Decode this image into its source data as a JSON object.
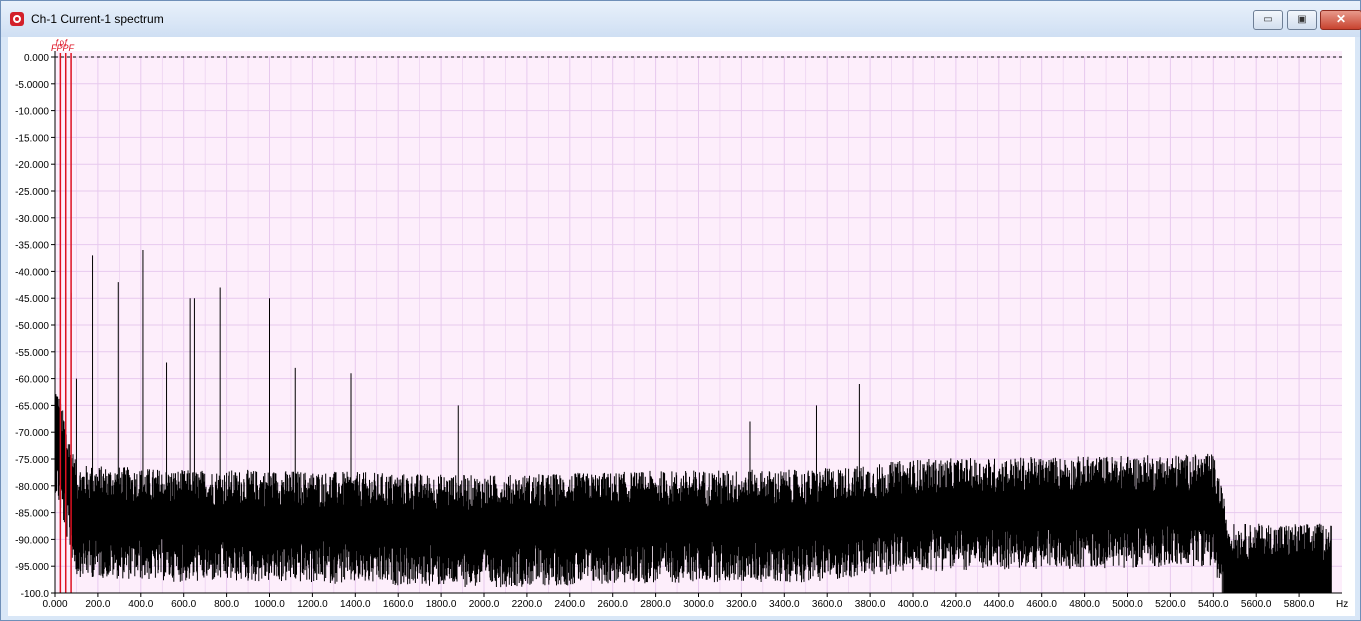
{
  "window": {
    "title": "Ch-1 Current-1 spectrum",
    "buttons": {
      "minimize": "▭",
      "maximize": "▣",
      "close": "✕"
    }
  },
  "colors": {
    "plot_bg": "#fdeefb",
    "grid": "#e7c9ee",
    "signal": "#000000",
    "marker": "#dd1122"
  },
  "markers": {
    "label": "FPPF",
    "header": "ƒρƒ"
  },
  "chart_data": {
    "type": "line",
    "xlabel": "Hz",
    "ylabel": "",
    "xlim": [
      0,
      5950
    ],
    "ylim": [
      -100,
      0
    ],
    "x_ticks": [
      "0.000",
      "200.0",
      "400.0",
      "600.0",
      "800.0",
      "1000.0",
      "1200.0",
      "1400.0",
      "1600.0",
      "1800.0",
      "2000.0",
      "2200.0",
      "2400.0",
      "2600.0",
      "2800.0",
      "3000.0",
      "3200.0",
      "3400.0",
      "3600.0",
      "3800.0",
      "4000.0",
      "4200.0",
      "4400.0",
      "4600.0",
      "4800.0",
      "5000.0",
      "5200.0",
      "5400.0",
      "5600.0",
      "5800.0"
    ],
    "y_ticks": [
      "0.000",
      "-5.0000",
      "-10.000",
      "-15.000",
      "-20.000",
      "-25.000",
      "-30.000",
      "-35.000",
      "-40.000",
      "-45.000",
      "-50.000",
      "-55.000",
      "-60.000",
      "-65.000",
      "-70.000",
      "-75.000",
      "-80.000",
      "-85.000",
      "-90.000",
      "-95.000",
      "-100.0"
    ],
    "reference_line": {
      "y": 0,
      "style": "dashed"
    },
    "marker_lines_x": [
      25,
      50,
      75
    ],
    "noise_floor": [
      [
        0,
        -70
      ],
      [
        100,
        -86
      ],
      [
        600,
        -87
      ],
      [
        1000,
        -87
      ],
      [
        2000,
        -88
      ],
      [
        3000,
        -87
      ],
      [
        3500,
        -87
      ],
      [
        3800,
        -86
      ],
      [
        4000,
        -85
      ],
      [
        5400,
        -84
      ],
      [
        5480,
        -97
      ],
      [
        5950,
        -97
      ]
    ],
    "peaks": [
      {
        "x": 25,
        "y": -58
      },
      {
        "x": 50,
        "y": -44
      },
      {
        "x": 75,
        "y": -44
      },
      {
        "x": 100,
        "y": -60
      },
      {
        "x": 175,
        "y": -37
      },
      {
        "x": 295,
        "y": -42
      },
      {
        "x": 410,
        "y": -36
      },
      {
        "x": 520,
        "y": -57
      },
      {
        "x": 630,
        "y": -45
      },
      {
        "x": 650,
        "y": -45
      },
      {
        "x": 770,
        "y": -43
      },
      {
        "x": 1000,
        "y": -45
      },
      {
        "x": 1120,
        "y": -58
      },
      {
        "x": 1380,
        "y": -59
      },
      {
        "x": 1880,
        "y": -65
      },
      {
        "x": 3240,
        "y": -68
      },
      {
        "x": 3550,
        "y": -65
      },
      {
        "x": 3750,
        "y": -61
      },
      {
        "x": 5200,
        "y": -78
      }
    ]
  }
}
